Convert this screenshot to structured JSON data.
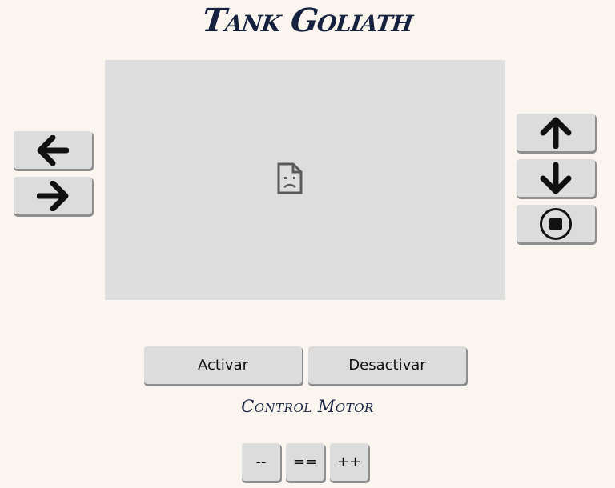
{
  "title": "Tank Goliath",
  "video_feed": {
    "icon": "broken-image-icon"
  },
  "steering": {
    "left_icon": "arrow-left-icon",
    "right_icon": "arrow-right-icon"
  },
  "drive": {
    "forward_icon": "arrow-up-icon",
    "backward_icon": "arrow-down-icon",
    "stop_icon": "stop-circle-icon"
  },
  "motor": {
    "activate_label": "Activar",
    "deactivate_label": "Desactivar",
    "section_label": "Control Motor",
    "decrease_label": "--",
    "reset_label": "==",
    "increase_label": "++"
  },
  "colors": {
    "background": "#faf5ef",
    "title": "#16213f",
    "button": "#dcdcdc",
    "video_placeholder": "#dedede"
  }
}
